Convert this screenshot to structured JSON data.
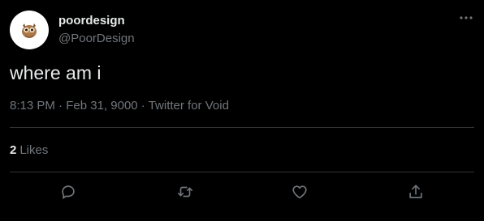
{
  "user": {
    "display_name": "poordesign",
    "handle": "@PoorDesign",
    "avatar_icon": "owl-avatar-icon"
  },
  "tweet": {
    "text": "where am i",
    "time": "8:13 PM",
    "separator": "·",
    "date": "Feb 31, 9000",
    "source": "Twitter for Void"
  },
  "stats": {
    "likes_count": "2",
    "likes_label": "Likes"
  },
  "actions": {
    "reply_icon": "speech-bubble-icon",
    "retweet_icon": "retweet-arrows-icon",
    "like_icon": "heart-icon",
    "share_icon": "share-arrow-icon",
    "more_icon": "ellipsis-icon"
  },
  "colors": {
    "background": "#000000",
    "primary_text": "#e7e9ea",
    "secondary_text": "#71767b",
    "divider": "#2f3336"
  }
}
